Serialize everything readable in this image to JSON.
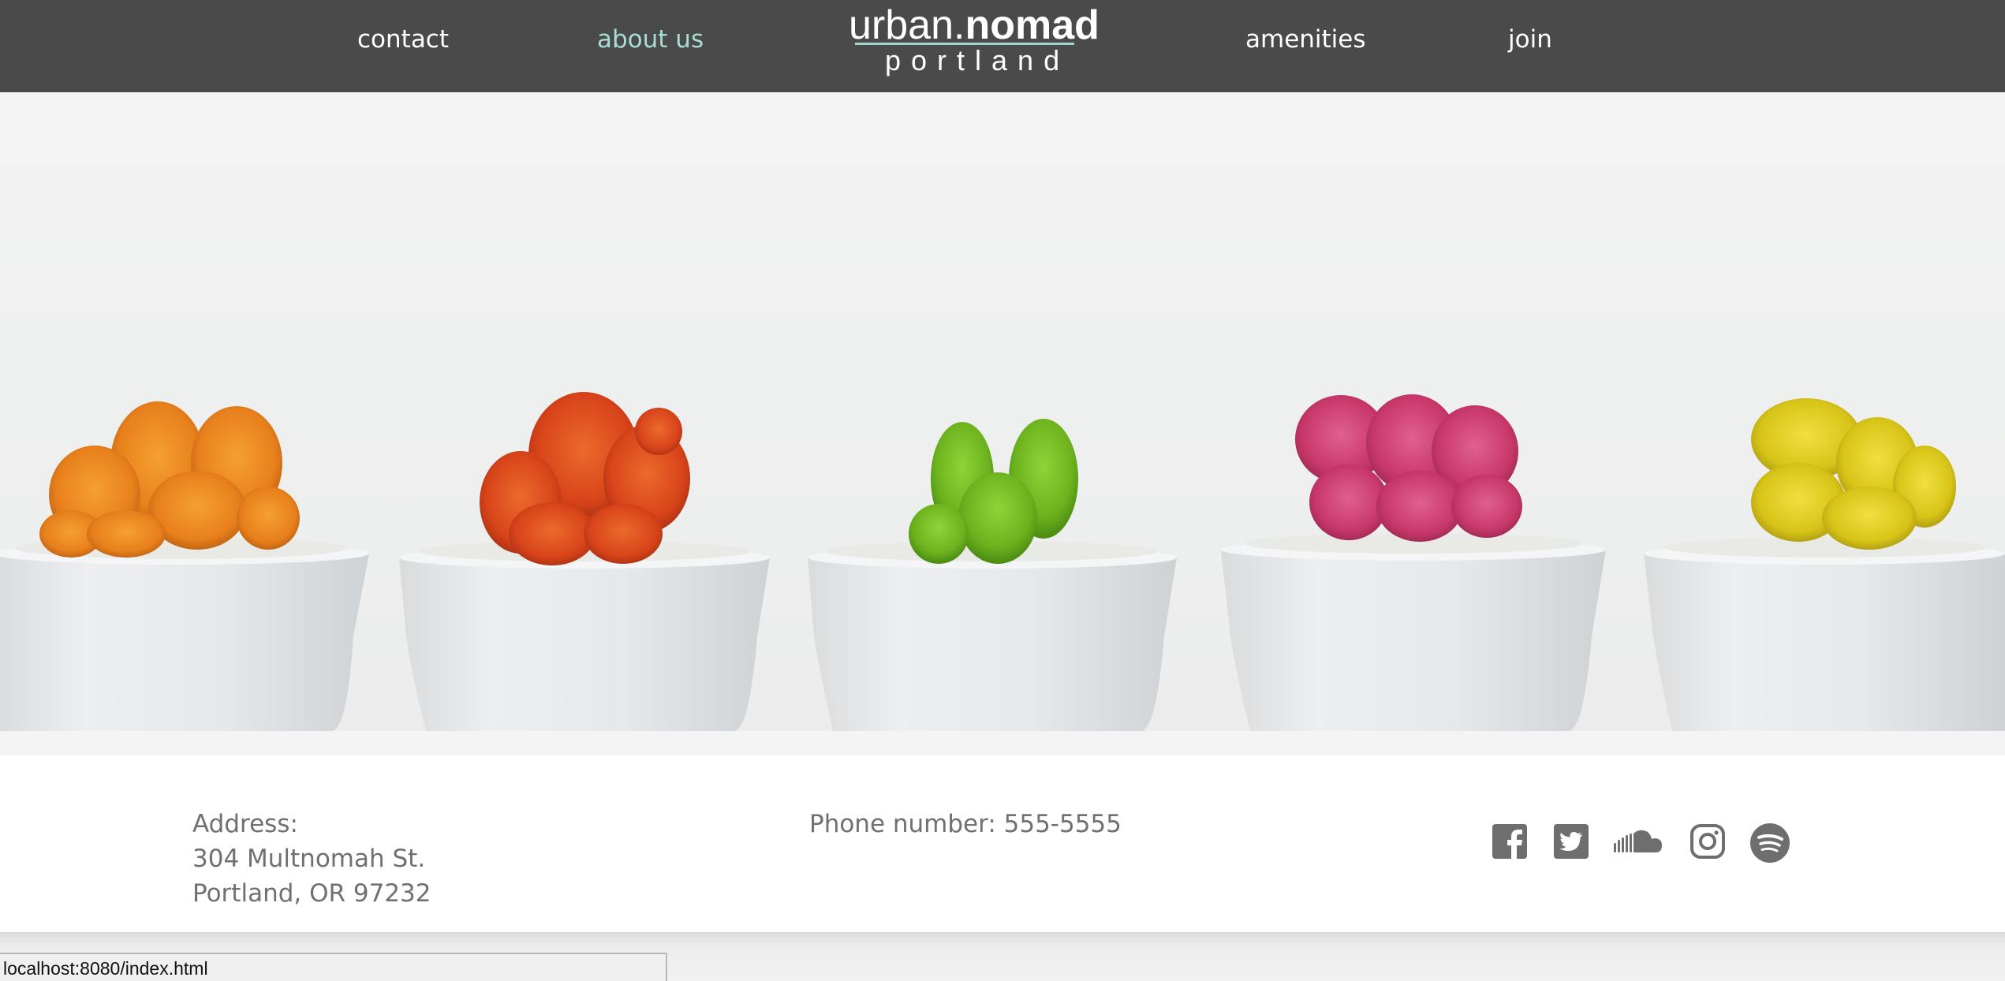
{
  "nav": {
    "contact": "contact",
    "about": "about us",
    "amenities": "amenities",
    "join": "join",
    "active_color": "#a8ddd6"
  },
  "logo": {
    "light": "urban.",
    "bold": "nomad",
    "sub": "portland"
  },
  "hero": {
    "image": "cactus-pots",
    "cactus_colors": [
      "#e8801c",
      "#d8441a",
      "#6cb21e",
      "#c8386a",
      "#d8c418"
    ]
  },
  "footer": {
    "address_label": "Address:",
    "address_line1": "304 Multnomah St.",
    "address_line2": "Portland, OR 97232",
    "phone": "Phone number: 555-5555",
    "social_icons": [
      "facebook-icon",
      "twitter-icon",
      "soundcloud-icon",
      "instagram-icon",
      "spotify-icon"
    ],
    "icon_color": "#6e6e6e"
  },
  "status": {
    "url": "localhost:8080/index.html"
  },
  "colors": {
    "navbar": "#4a4a4a",
    "background": "#f4f4f4",
    "text": "#707070"
  }
}
